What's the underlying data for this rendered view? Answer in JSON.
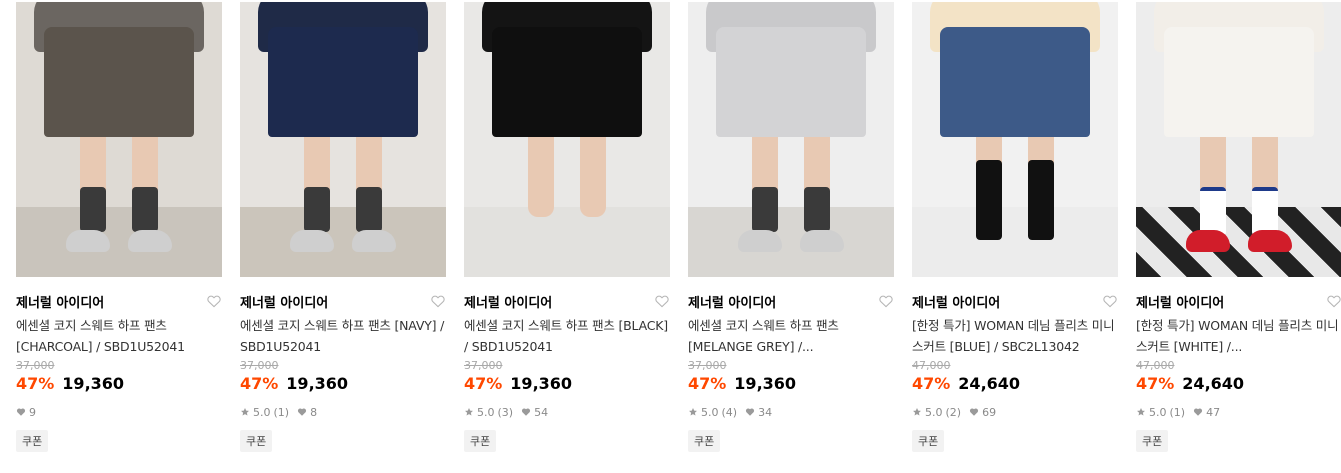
{
  "products": [
    {
      "brand": "제너럴 아이디어",
      "title": "에센셜 코지 스웨트 하프 팬츠 [CHARCOAL] / SBD1U52041",
      "original_price": "37,000",
      "discount": "47%",
      "price": "19,360",
      "rating": "",
      "review_count": "",
      "likes": "9",
      "coupon": "쿠폰",
      "colors": {
        "bg": "#dedad4",
        "top": "#6b6661",
        "shorts": "#5b544c",
        "floor": "#c9c4bc"
      }
    },
    {
      "brand": "제너럴 아이디어",
      "title": "에센셜 코지 스웨트 하프 팬츠 [NAVY] / SBD1U52041",
      "original_price": "37,000",
      "discount": "47%",
      "price": "19,360",
      "rating": "5.0",
      "review_count": "(1)",
      "likes": "8",
      "coupon": "쿠폰",
      "colors": {
        "bg": "#e6e3df",
        "top": "#1f2a47",
        "shorts": "#1d2a4e",
        "floor": "#cbc5bb"
      }
    },
    {
      "brand": "제너럴 아이디어",
      "title": "에센셜 코지 스웨트 하프 팬츠 [BLACK] / SBD1U52041",
      "original_price": "37,000",
      "discount": "47%",
      "price": "19,360",
      "rating": "5.0",
      "review_count": "(3)",
      "likes": "54",
      "coupon": "쿠폰",
      "colors": {
        "bg": "#e9e8e6",
        "top": "#141414",
        "shorts": "#0f0f0f",
        "floor": "#e2e1de"
      }
    },
    {
      "brand": "제너럴 아이디어",
      "title": "에센셜 코지 스웨트 하프 팬츠 [MELANGE GREY] /...",
      "original_price": "37,000",
      "discount": "47%",
      "price": "19,360",
      "rating": "5.0",
      "review_count": "(4)",
      "likes": "34",
      "coupon": "쿠폰",
      "colors": {
        "bg": "#eeeeee",
        "top": "#c9c9cb",
        "shorts": "#d3d3d5",
        "floor": "#d8d6d2"
      }
    },
    {
      "brand": "제너럴 아이디어",
      "title": "[한정 특가] WOMAN 데님 플리츠 미니스커트 [BLUE] / SBC2L13042",
      "original_price": "47,000",
      "discount": "47%",
      "price": "24,640",
      "rating": "5.0",
      "review_count": "(2)",
      "likes": "69",
      "coupon": "쿠폰",
      "colors": {
        "bg": "#f1f1f1",
        "top": "#f3e3c6",
        "shorts": "#3d5a88",
        "floor": "#ececec"
      }
    },
    {
      "brand": "제너럴 아이디어",
      "title": "[한정 특가] WOMAN 데님 플리츠 미니스커트 [WHITE] /...",
      "original_price": "47,000",
      "discount": "47%",
      "price": "24,640",
      "rating": "5.0",
      "review_count": "(1)",
      "likes": "47",
      "coupon": "쿠폰",
      "colors": {
        "bg": "#ededed",
        "top": "#f2eee8",
        "shorts": "#f5f3ef",
        "floor": "#dcdcdc"
      }
    }
  ],
  "icons": {
    "heart": "heart-outline-icon",
    "star": "star-icon",
    "like": "heart-filled-icon"
  }
}
